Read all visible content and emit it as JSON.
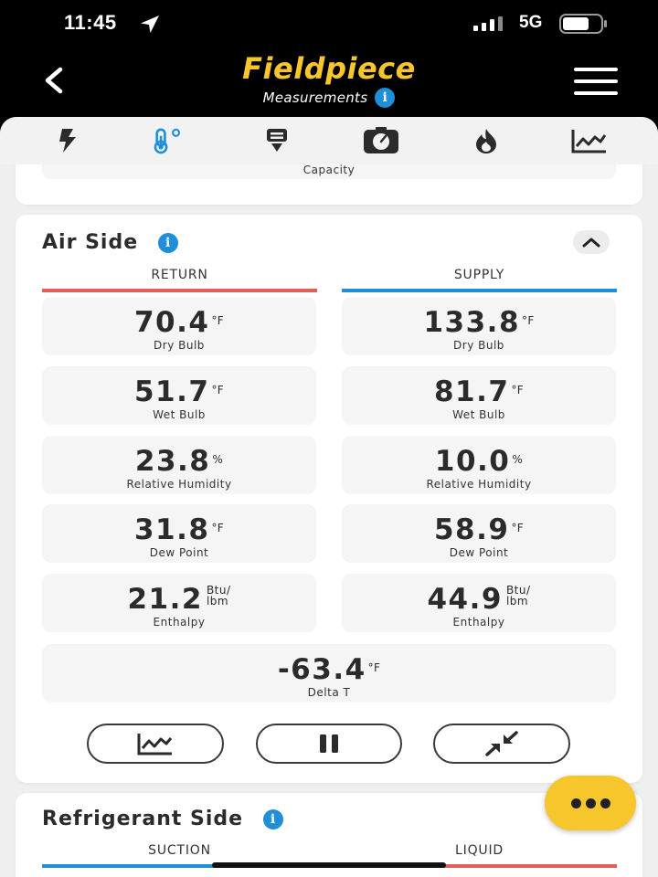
{
  "status_bar": {
    "time": "11:45",
    "network": "5G"
  },
  "header": {
    "logo": "Fieldpiece",
    "subtitle": "Measurements",
    "info": "i"
  },
  "tabs": [
    "electrical-icon",
    "temperature-icon",
    "download-icon",
    "gauge-icon",
    "flame-icon",
    "chart-icon"
  ],
  "capacity_card": {
    "label": "Capacity"
  },
  "air_side": {
    "title": "Air Side",
    "return_label": "RETURN",
    "supply_label": "SUPPLY",
    "return": [
      {
        "value": "70.4",
        "unit": "°F",
        "label": "Dry Bulb"
      },
      {
        "value": "51.7",
        "unit": "°F",
        "label": "Wet Bulb"
      },
      {
        "value": "23.8",
        "unit": "%",
        "label": "Relative Humidity"
      },
      {
        "value": "31.8",
        "unit": "°F",
        "label": "Dew Point"
      },
      {
        "value": "21.2",
        "unit_top": "Btu/",
        "unit_bottom": "lbm",
        "label": "Enthalpy"
      }
    ],
    "supply": [
      {
        "value": "133.8",
        "unit": "°F",
        "label": "Dry Bulb"
      },
      {
        "value": "81.7",
        "unit": "°F",
        "label": "Wet Bulb"
      },
      {
        "value": "10.0",
        "unit": "%",
        "label": "Relative Humidity"
      },
      {
        "value": "58.9",
        "unit": "°F",
        "label": "Dew Point"
      },
      {
        "value": "44.9",
        "unit_top": "Btu/",
        "unit_bottom": "lbm",
        "label": "Enthalpy"
      }
    ],
    "delta": {
      "value": "-63.4",
      "unit": "°F",
      "label": "Delta T"
    }
  },
  "refrigerant_side": {
    "title": "Refrigerant Side",
    "suction_label": "SUCTION",
    "liquid_label": "LIQUID"
  },
  "colors": {
    "accent_yellow": "#f7c52c",
    "return_red": "#e0605a",
    "supply_blue": "#1e8fd8"
  }
}
